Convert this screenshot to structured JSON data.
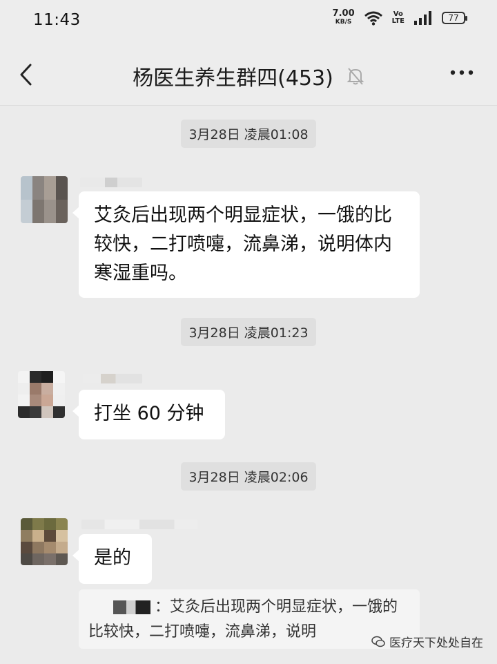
{
  "status": {
    "time": "11:43",
    "speed_value": "7.00",
    "speed_unit": "KB/S",
    "volte_top": "Vo",
    "volte_bottom": "LTE",
    "battery": "77"
  },
  "header": {
    "title": "杨医生养生群四(453)"
  },
  "messages": [
    {
      "timestamp": "3月28日 凌晨01:08",
      "text": "艾灸后出现两个明显症状，一饿的比较快，二打喷嚏，流鼻涕，说明体内寒湿重吗。"
    },
    {
      "timestamp": "3月28日 凌晨01:23",
      "text": "打坐 60 分钟"
    },
    {
      "timestamp": "3月28日 凌晨02:06",
      "text": "是的"
    }
  ],
  "quote": {
    "text": "：艾灸后出现两个明显症状，一饿的比较快，二打喷嚏，流鼻涕，说明"
  },
  "watermark": {
    "text": "医疗天下处处自在"
  },
  "colors": {
    "background": "#ebebeb",
    "bubble": "#ffffff",
    "timestamp_bg": "#dfdfdf"
  }
}
